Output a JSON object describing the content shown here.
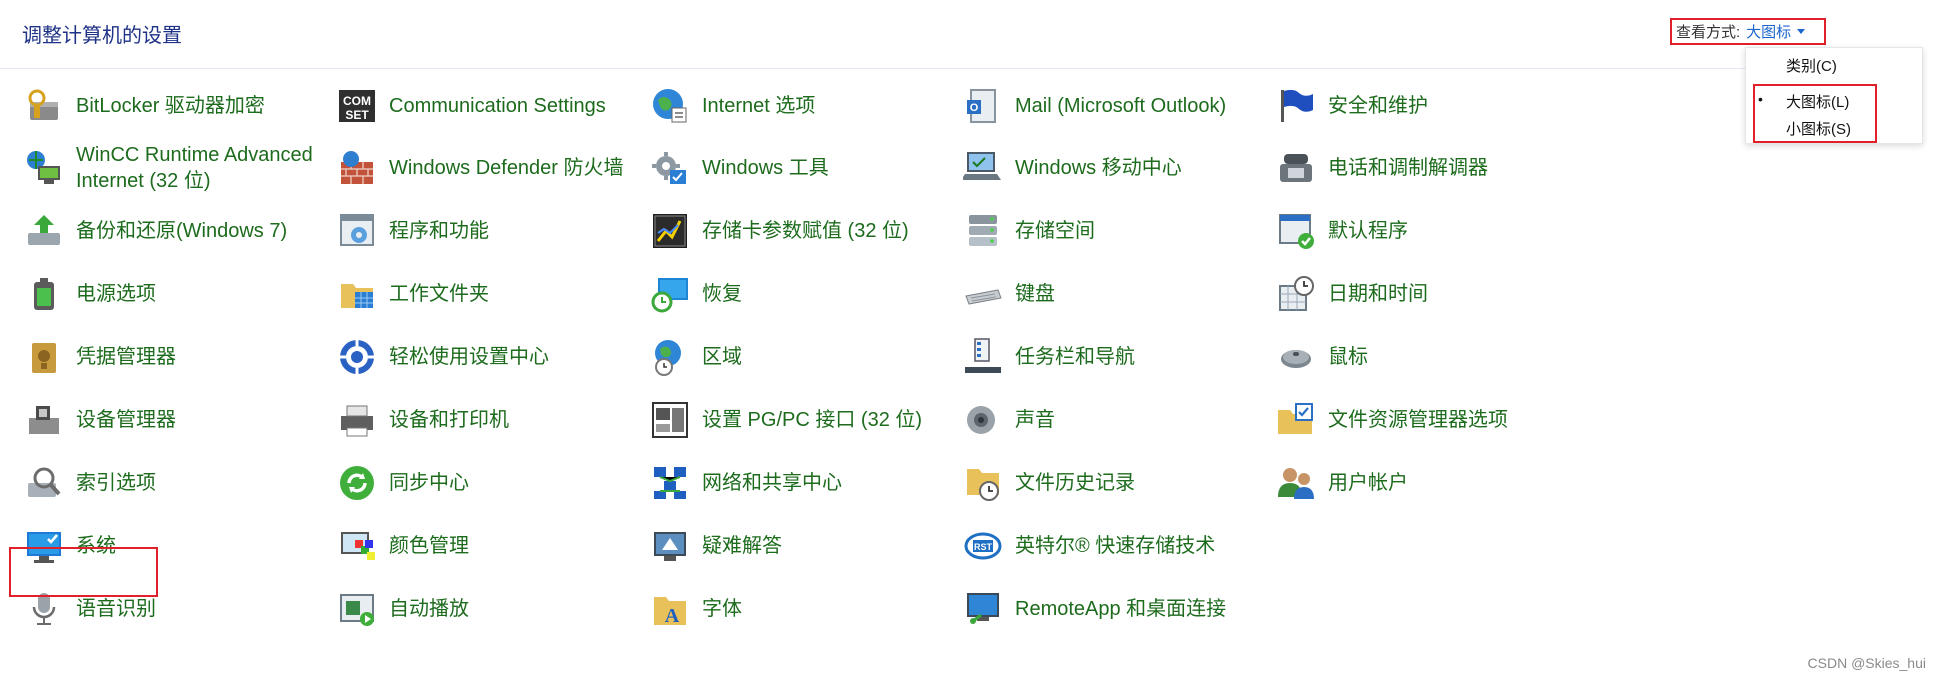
{
  "header": {
    "title": "调整计算机的设置",
    "view_by_label": "查看方式:",
    "view_by_value": "大图标"
  },
  "dropdown": {
    "items": [
      {
        "label": "类别(C)",
        "selected": false
      },
      {
        "label": "大图标(L)",
        "selected": true
      },
      {
        "label": "小图标(S)",
        "selected": false
      }
    ]
  },
  "items": [
    {
      "label": "BitLocker 驱动器加密",
      "icon": "bitlocker-icon"
    },
    {
      "label": "WinCC Runtime Advanced Internet (32 位)",
      "icon": "wincc-icon"
    },
    {
      "label": "备份和还原(Windows 7)",
      "icon": "backup-icon"
    },
    {
      "label": "电源选项",
      "icon": "power-icon"
    },
    {
      "label": "凭据管理器",
      "icon": "credential-icon"
    },
    {
      "label": "设备管理器",
      "icon": "device-manager-icon"
    },
    {
      "label": "索引选项",
      "icon": "indexing-icon"
    },
    {
      "label": "系统",
      "icon": "system-icon"
    },
    {
      "label": "语音识别",
      "icon": "microphone-icon"
    },
    {
      "label": "Communication Settings",
      "icon": "comset-icon"
    },
    {
      "label": "Windows Defender 防火墙",
      "icon": "firewall-icon"
    },
    {
      "label": "程序和功能",
      "icon": "programs-icon"
    },
    {
      "label": "工作文件夹",
      "icon": "work-folders-icon"
    },
    {
      "label": "轻松使用设置中心",
      "icon": "ease-of-access-icon"
    },
    {
      "label": "设备和打印机",
      "icon": "printer-icon"
    },
    {
      "label": "同步中心",
      "icon": "sync-icon"
    },
    {
      "label": "颜色管理",
      "icon": "color-icon"
    },
    {
      "label": "自动播放",
      "icon": "autoplay-icon"
    },
    {
      "label": "Internet 选项",
      "icon": "internet-icon"
    },
    {
      "label": "Windows 工具",
      "icon": "tools-icon"
    },
    {
      "label": "存储卡参数赋值 (32 位)",
      "icon": "memory-card-icon"
    },
    {
      "label": "恢复",
      "icon": "recovery-icon"
    },
    {
      "label": "区域",
      "icon": "region-icon"
    },
    {
      "label": "设置 PG/PC 接口 (32 位)",
      "icon": "pgpc-icon"
    },
    {
      "label": "网络和共享中心",
      "icon": "network-icon"
    },
    {
      "label": "疑难解答",
      "icon": "troubleshoot-icon"
    },
    {
      "label": "字体",
      "icon": "font-icon"
    },
    {
      "label": "Mail (Microsoft Outlook)",
      "icon": "mail-icon"
    },
    {
      "label": "Windows 移动中心",
      "icon": "mobility-icon"
    },
    {
      "label": "存储空间",
      "icon": "storage-icon"
    },
    {
      "label": "键盘",
      "icon": "keyboard-icon"
    },
    {
      "label": "任务栏和导航",
      "icon": "taskbar-icon"
    },
    {
      "label": "声音",
      "icon": "speaker-icon"
    },
    {
      "label": "文件历史记录",
      "icon": "file-history-icon"
    },
    {
      "label": "英特尔® 快速存储技术",
      "icon": "intel-rst-icon"
    },
    {
      "label": "RemoteApp 和桌面连接",
      "icon": "remoteapp-icon"
    },
    {
      "label": "安全和维护",
      "icon": "flag-icon"
    },
    {
      "label": "电话和调制解调器",
      "icon": "phone-icon"
    },
    {
      "label": "默认程序",
      "icon": "default-programs-icon"
    },
    {
      "label": "日期和时间",
      "icon": "clock-icon"
    },
    {
      "label": "鼠标",
      "icon": "mouse-icon"
    },
    {
      "label": "文件资源管理器选项",
      "icon": "folder-options-icon"
    },
    {
      "label": "用户帐户",
      "icon": "users-icon"
    }
  ],
  "watermark": "CSDN @Skies_hui"
}
